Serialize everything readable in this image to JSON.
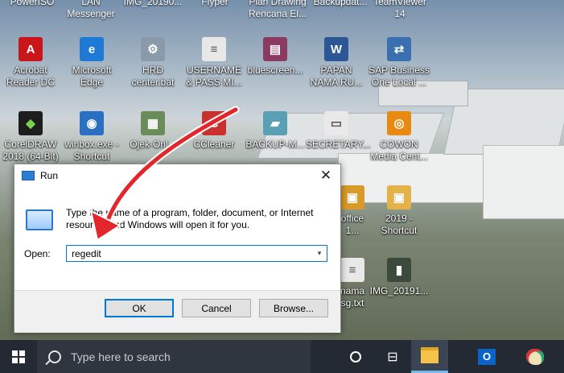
{
  "desktop": {
    "top_row": [
      {
        "label": "PowerISO"
      },
      {
        "label": "LAN\nMessenger"
      },
      {
        "label": "IMG_20190..."
      },
      {
        "label": "Flyper"
      },
      {
        "label": "Plan Drawing\nRencana El..."
      },
      {
        "label": "Backupdat..."
      },
      {
        "label": "TeamViewer\n14"
      }
    ],
    "icons": [
      {
        "label": "Acrobat\nReader DC",
        "glyph": "A",
        "color": "#c9161b"
      },
      {
        "label": "Microsoft\nEdge",
        "glyph": "e",
        "color": "#1f7ad6"
      },
      {
        "label": "HRD\ncenter.bat",
        "glyph": "⚙",
        "color": "#8a9aa8"
      },
      {
        "label": "USERNAME\n& PASS MI...",
        "glyph": "≡",
        "color": "#e8e8e8"
      },
      {
        "label": "bluescreen...",
        "glyph": "▤",
        "color": "#8b3a62"
      },
      {
        "label": "PAPAN\nNAMA RU...",
        "glyph": "W",
        "color": "#2b5797"
      },
      {
        "label": "SAP Business\nOne Local ...",
        "glyph": "⇄",
        "color": "#3a6fb0"
      },
      {
        "label": "CorelDRAW\n2018 (64-Bit)",
        "glyph": "◆",
        "color": "#1d1d1d"
      },
      {
        "label": "winbox.exe -\nShortcut",
        "glyph": "◉",
        "color": "#2a6fc1"
      },
      {
        "label": "Ojek-Onl...",
        "glyph": "▦",
        "color": "#6c8b5a"
      },
      {
        "label": "CCleaner",
        "glyph": "C",
        "color": "#c8312e"
      },
      {
        "label": "BACKUP-M...",
        "glyph": "▰",
        "color": "#5aa0b5"
      },
      {
        "label": "SECRETARY...",
        "glyph": "▭",
        "color": "#e9e9e9"
      },
      {
        "label": "COWON\nMedia Cent...",
        "glyph": "◎",
        "color": "#e88a12"
      },
      {
        "label": "office\n1...",
        "glyph": "▣",
        "color": "#d89a2b"
      },
      {
        "label": "2019 -\nShortcut",
        "glyph": "▣",
        "color": "#e3b34a"
      },
      {
        "label": "nama\nsg.txt",
        "glyph": "≡",
        "color": "#e8e8e8"
      },
      {
        "label": "IMG_20191...",
        "glyph": "▮",
        "color": "#3b4a3c"
      }
    ]
  },
  "run_dialog": {
    "title": "Run",
    "close_glyph": "✕",
    "description": "Type the name of a program, folder, document, or Internet resource, and Windows will open it for you.",
    "open_label": "Open:",
    "open_value": "regedit",
    "dropdown_glyph": "▾",
    "ok_label": "OK",
    "cancel_label": "Cancel",
    "browse_label": "Browse..."
  },
  "taskbar": {
    "search_placeholder": "Type here to search"
  },
  "colors": {
    "taskbar_bg": "#232a33",
    "accent": "#0078d7",
    "arrow": "#e3262b"
  }
}
